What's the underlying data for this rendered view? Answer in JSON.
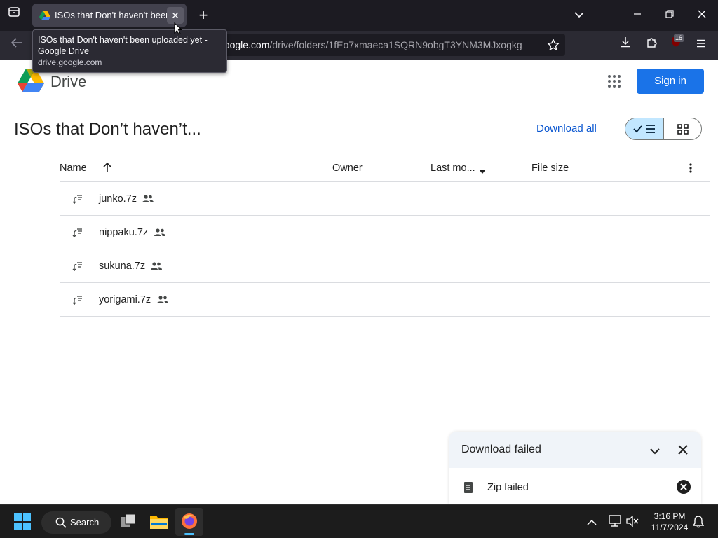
{
  "browser": {
    "tab_title": "ISOs that Don't haven't been uploaded yet - Google Drive",
    "tab_close": "✕",
    "new_tab": "+",
    "url_host": "drive.google.com",
    "url_path": "/drive/folders/1fEo7xmaeca1SQRN9obgT3YNM3MJxogkg",
    "url_visible_host": "google.com",
    "extension_badge": "16",
    "tooltip": {
      "title": "ISOs that Don't haven't been uploaded yet - Google Drive",
      "host": "drive.google.com"
    }
  },
  "drive": {
    "logo_text": "Drive",
    "sign_in": "Sign in",
    "folder_title": "ISOs that Don’t haven’t...",
    "download_all": "Download all",
    "columns": {
      "name": "Name",
      "owner": "Owner",
      "last_modified": "Last mo...",
      "file_size": "File size"
    },
    "files": [
      {
        "name": "junko.7z"
      },
      {
        "name": "nippaku.7z"
      },
      {
        "name": "sukuna.7z"
      },
      {
        "name": "yorigami.7z"
      }
    ]
  },
  "download_panel": {
    "title": "Download failed",
    "item": "Zip failed"
  },
  "taskbar": {
    "search_label": "Search",
    "time": "3:16 PM",
    "date": "11/7/2024"
  },
  "colors": {
    "accent_blue": "#1a73e8",
    "link_blue": "#0b57d0",
    "toggle_selected": "#c2e7ff"
  }
}
